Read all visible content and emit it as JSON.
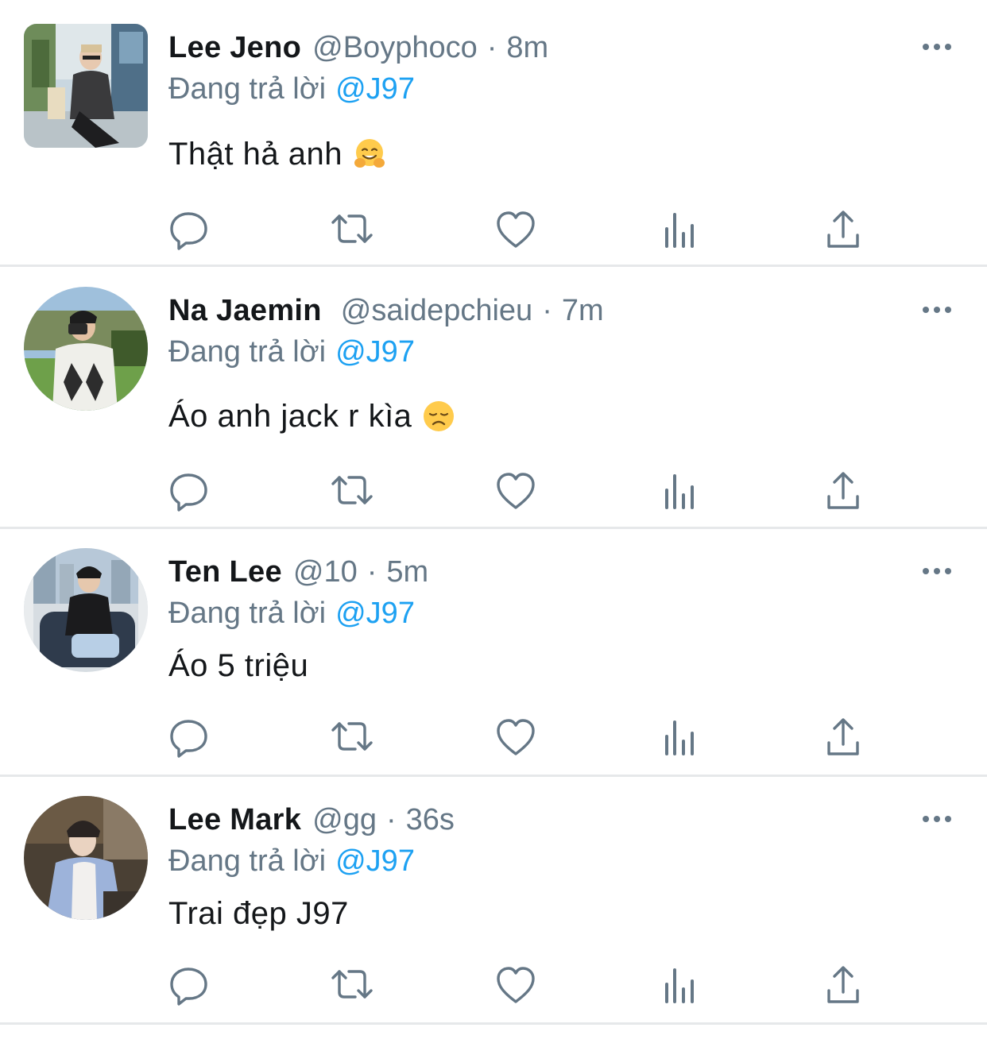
{
  "reply_prefix": "Đang trả lời",
  "tweets": [
    {
      "name": "Lee Jeno",
      "handle": "@Boyphoco",
      "separator": "·",
      "time": "8m",
      "reply_to": "@J97",
      "text": "Thật hả anh",
      "emoji_icon": "hugging-face-emoji"
    },
    {
      "name": "Na Jaemin",
      "handle": "@saidepchieu",
      "separator": "·",
      "time": "7m",
      "reply_to": "@J97",
      "text": "Áo anh jack r kìa",
      "emoji_icon": "disappointed-face-emoji"
    },
    {
      "name": "Ten Lee",
      "handle": "@10",
      "separator": "·",
      "time": "5m",
      "reply_to": "@J97",
      "text": "Áo 5 triệu",
      "emoji_icon": ""
    },
    {
      "name": "Lee Mark",
      "handle": "@gg",
      "separator": "·",
      "time": "36s",
      "reply_to": "@J97",
      "text": "Trai đẹp J97",
      "emoji_icon": ""
    }
  ],
  "action_icons": [
    "reply-icon",
    "retweet-icon",
    "like-icon",
    "analytics-icon",
    "share-icon"
  ],
  "colors": {
    "text": "#14171a",
    "secondary": "#657786",
    "link": "#1da1f2",
    "divider": "#e6e8ea"
  }
}
